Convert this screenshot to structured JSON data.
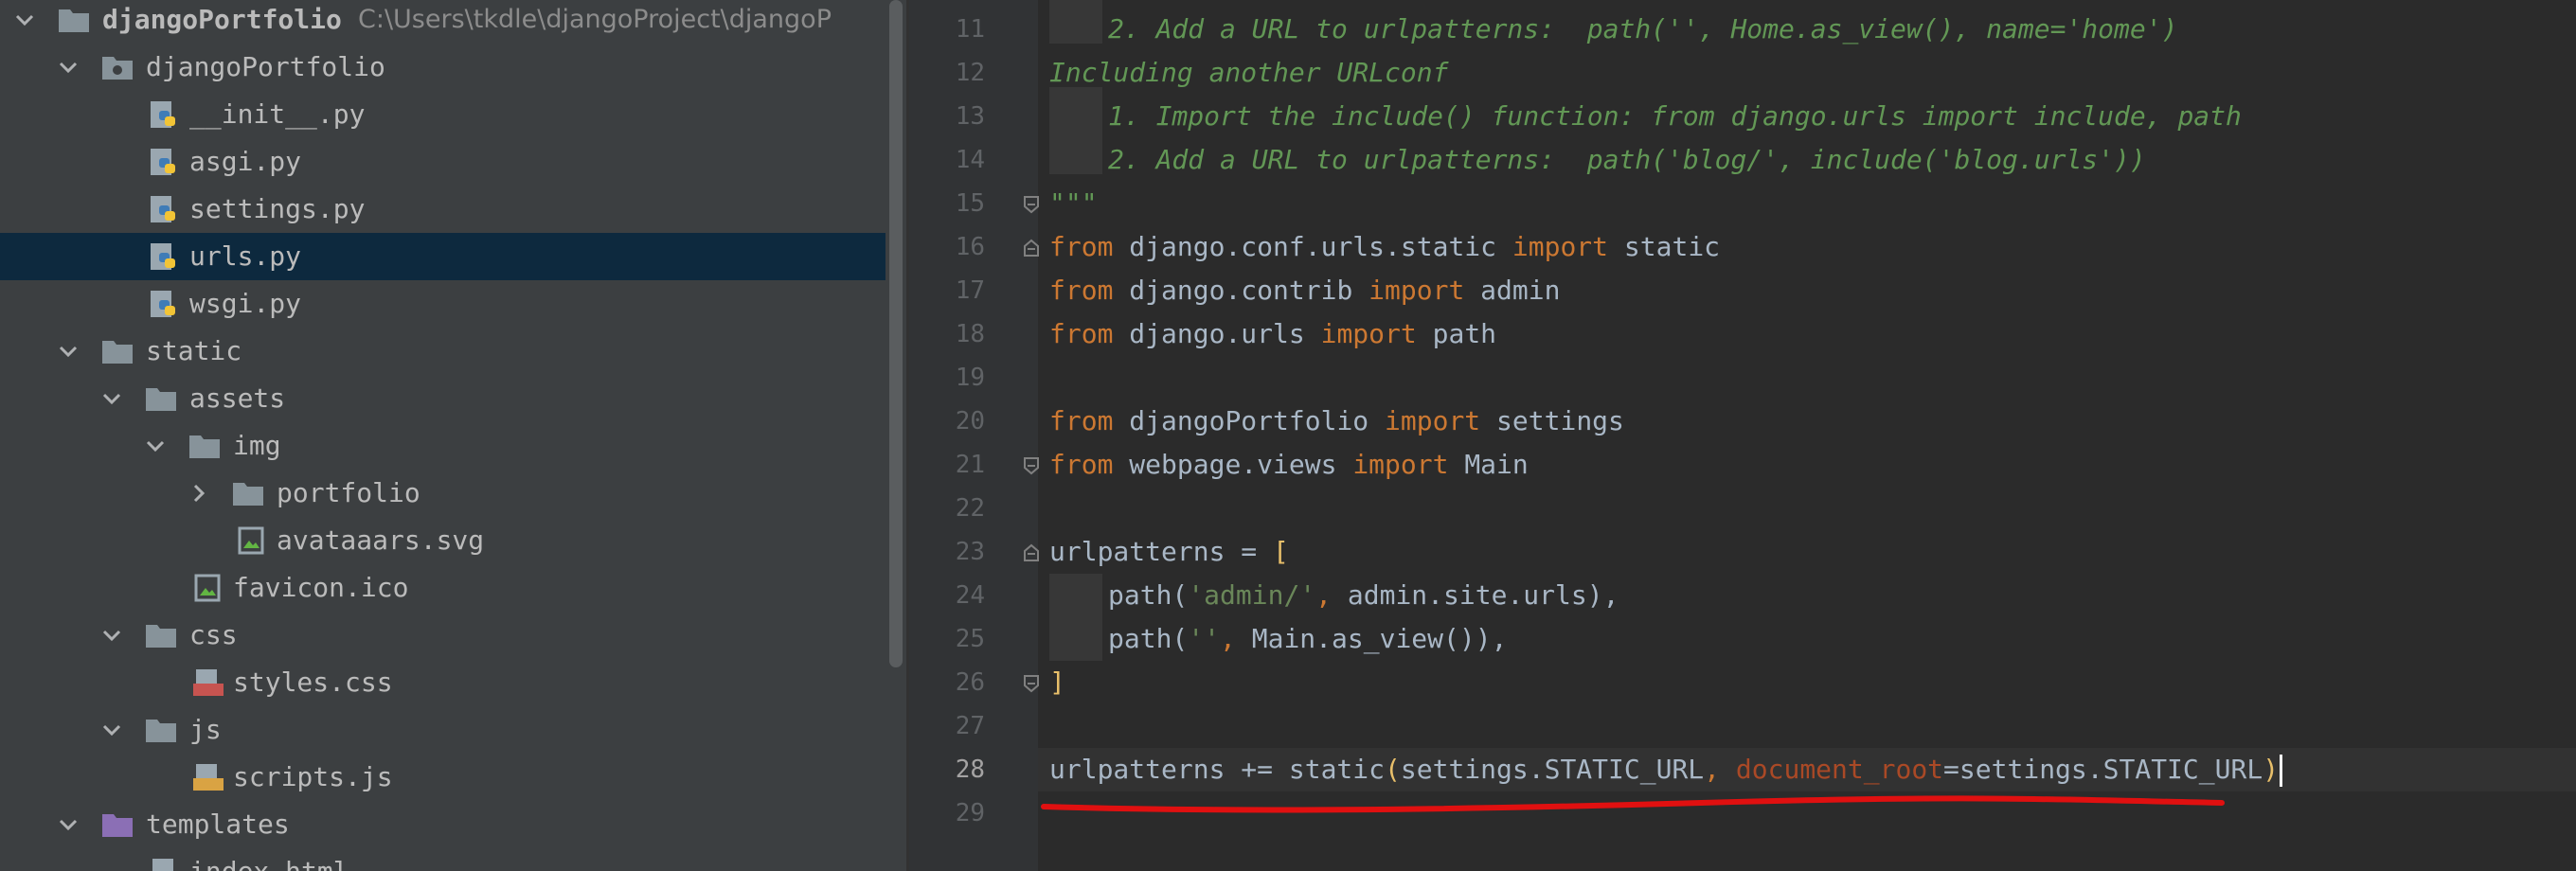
{
  "project_tree": {
    "root": {
      "name": "djangoPortfolio",
      "path": "C:\\Users\\tkdle\\djangoProject\\djangoP"
    },
    "items": [
      {
        "name": "djangoPortfolio"
      },
      {
        "name": "__init__.py"
      },
      {
        "name": "asgi.py"
      },
      {
        "name": "settings.py"
      },
      {
        "name": "urls.py"
      },
      {
        "name": "wsgi.py"
      },
      {
        "name": "static"
      },
      {
        "name": "assets"
      },
      {
        "name": "img"
      },
      {
        "name": "portfolio"
      },
      {
        "name": "avataaars.svg"
      },
      {
        "name": "favicon.ico"
      },
      {
        "name": "css"
      },
      {
        "name": "styles.css"
      },
      {
        "name": "js"
      },
      {
        "name": "scripts.js"
      },
      {
        "name": "templates"
      },
      {
        "name": "index.html"
      }
    ]
  },
  "editor": {
    "line_numbers": [
      "11",
      "12",
      "13",
      "14",
      "15",
      "16",
      "17",
      "18",
      "19",
      "20",
      "21",
      "22",
      "23",
      "24",
      "25",
      "26",
      "27",
      "28",
      "29"
    ],
    "current_line": "28",
    "tokens": {
      "l11": {
        "a": "2. Add a URL to urlpatterns:  path('', Home.as_view(), name='home')"
      },
      "l12": {
        "a": "Including another URLconf"
      },
      "l13": {
        "a": "1. Import the include() function: from django.urls import include, path"
      },
      "l14": {
        "a": "2. Add a URL to urlpatterns:  path('blog/', include('blog.urls'))"
      },
      "l15": {
        "a": "\"\"\""
      },
      "l16": {
        "a": "from",
        "b": " django.conf.urls.static ",
        "c": "import",
        "d": " static"
      },
      "l17": {
        "a": "from",
        "b": " django.contrib ",
        "c": "import",
        "d": " admin"
      },
      "l18": {
        "a": "from",
        "b": " django.urls ",
        "c": "import",
        "d": " path"
      },
      "l20": {
        "a": "from",
        "b": " djangoPortfolio ",
        "c": "import",
        "d": " settings"
      },
      "l21": {
        "a": "from",
        "b": " webpage.views ",
        "c": "import",
        "d": " Main"
      },
      "l23": {
        "a": "urlpatterns = ",
        "b": "["
      },
      "l24": {
        "a": "path(",
        "b": "'admin/'",
        "c": ", ",
        "d": "admin.site.urls),"
      },
      "l25": {
        "a": "path(",
        "b": "''",
        "c": ", ",
        "d": "Main.as_view()),"
      },
      "l26": {
        "a": "]"
      },
      "l28": {
        "a": "urlpatterns += static",
        "b": "(",
        "c": "settings.STATIC_URL",
        "d": ", ",
        "e": "document_root",
        "f": "=settings.STATIC_URL",
        "g": ")"
      }
    }
  },
  "colors": {
    "annotation_underline": "#e01010",
    "keyword": "#cc7832",
    "comment": "#629755",
    "string": "#6a8759",
    "selection": "#0d293e"
  }
}
